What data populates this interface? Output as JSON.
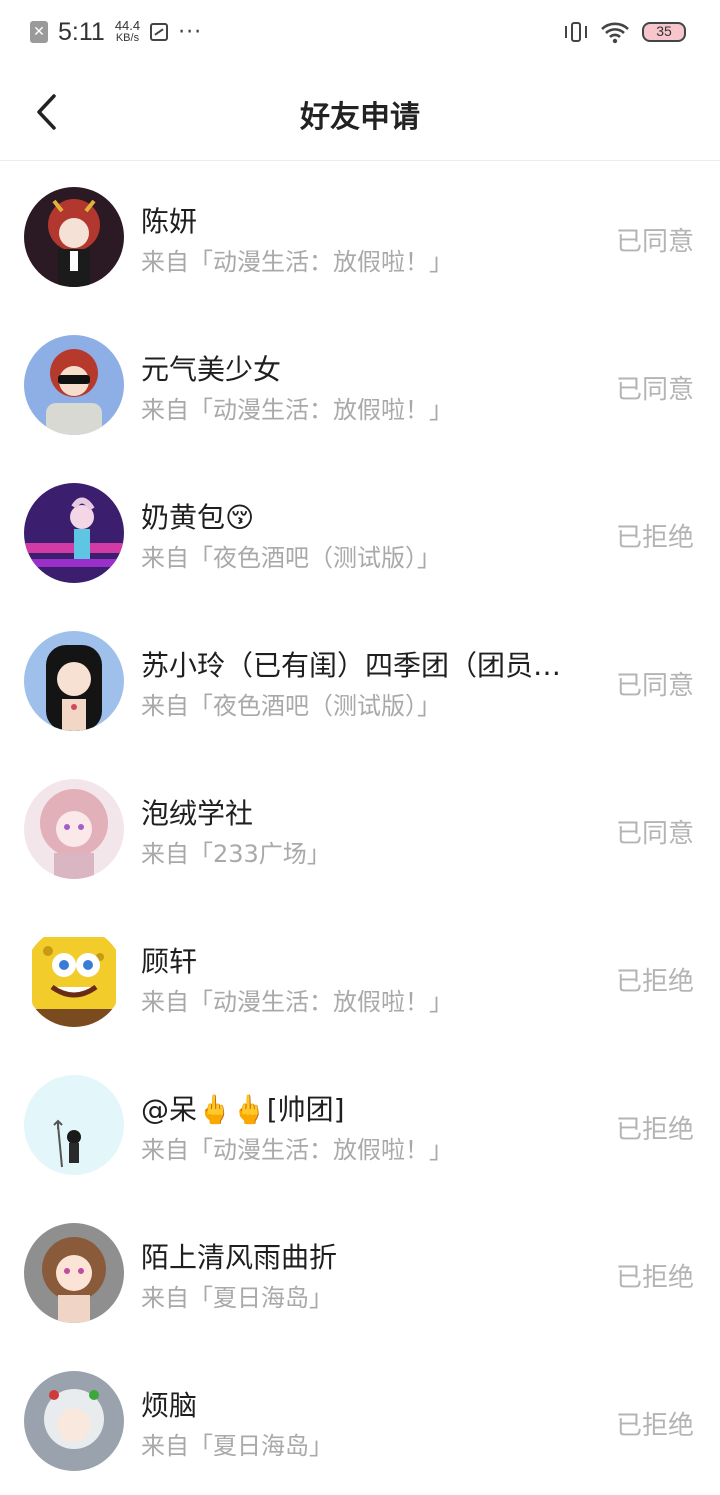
{
  "status_bar": {
    "time": "5:11",
    "net_speed_value": "44.4",
    "net_speed_unit": "KB/s",
    "more": "···",
    "battery": "35"
  },
  "header": {
    "title": "好友申请"
  },
  "requests": [
    {
      "name": "陈妍",
      "source": "来自「动漫生活：放假啦！」",
      "status": "已同意",
      "avatar": "anime-girl-red-hair"
    },
    {
      "name": "元气美少女",
      "source": "来自「动漫生活：放假啦！」",
      "status": "已同意",
      "avatar": "anime-boy-sunglasses"
    },
    {
      "name": "奶黄包😚",
      "source": "来自「夜色酒吧（测试版）」",
      "status": "已拒绝",
      "avatar": "anime-girl-stage"
    },
    {
      "name": "苏小玲（已有闺）四季团（团员…",
      "source": "来自「夜色酒吧（测试版）」",
      "status": "已同意",
      "avatar": "anime-girl-black-hair"
    },
    {
      "name": "泡绒学社",
      "source": "来自「233广场」",
      "status": "已同意",
      "avatar": "anime-girl-pink-hair"
    },
    {
      "name": "顾轩",
      "source": "来自「动漫生活：放假啦！」",
      "status": "已拒绝",
      "avatar": "spongebob"
    },
    {
      "name": "@呆🖕🖕[帅团]",
      "source": "来自「动漫生活：放假啦！」",
      "status": "已拒绝",
      "avatar": "chibi-trident"
    },
    {
      "name": "陌上清风雨曲折",
      "source": "来自「夏日海岛」",
      "status": "已拒绝",
      "avatar": "anime-girl-brown-hair"
    },
    {
      "name": "烦脑",
      "source": "来自「夏日海岛」",
      "status": "已拒绝",
      "avatar": "anime-white-hair"
    }
  ]
}
